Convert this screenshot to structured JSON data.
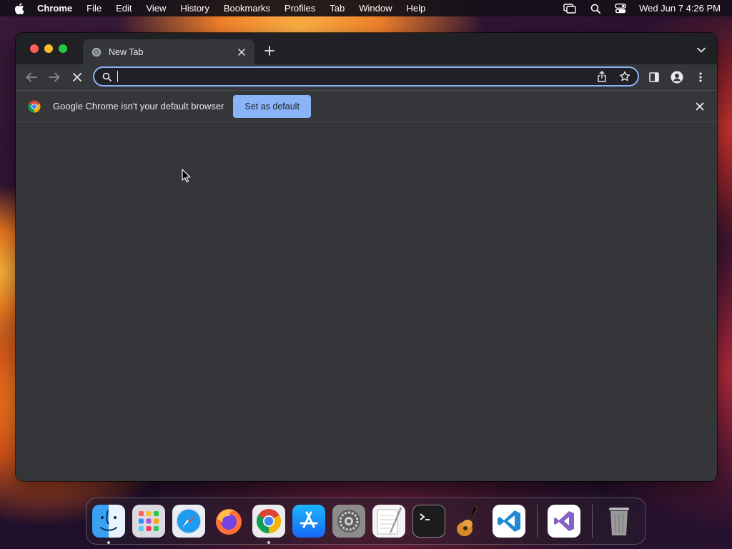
{
  "menubar": {
    "app_name": "Chrome",
    "items": [
      "File",
      "Edit",
      "View",
      "History",
      "Bookmarks",
      "Profiles",
      "Tab",
      "Window",
      "Help"
    ],
    "datetime": "Wed Jun 7  4:26 PM"
  },
  "tab": {
    "title": "New Tab"
  },
  "omnibox": {
    "value": "",
    "placeholder": ""
  },
  "infobar": {
    "message": "Google Chrome isn't your default browser",
    "button_label": "Set as default"
  },
  "colors": {
    "accent": "#8ab4f8",
    "window_bg": "#35363a",
    "tabstrip_bg": "#202124"
  },
  "dock": {
    "apps": [
      "Finder",
      "Launchpad",
      "Safari",
      "Firefox",
      "Google Chrome",
      "App Store",
      "System Preferences",
      "TextEdit",
      "Terminal",
      "GarageBand",
      "Visual Studio Code",
      "Visual Studio",
      "Trash"
    ],
    "running": [
      "Finder",
      "Google Chrome"
    ]
  }
}
